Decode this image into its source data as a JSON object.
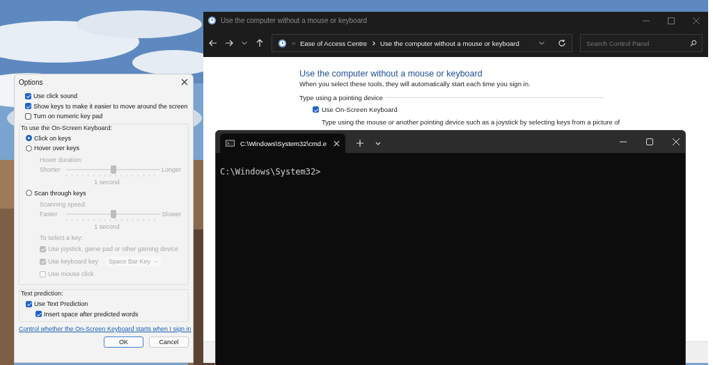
{
  "options": {
    "title": "Options",
    "checkboxes": [
      {
        "label": "Use click sound",
        "checked": true
      },
      {
        "label": "Show keys to make it easier to move around the screen",
        "checked": true
      },
      {
        "label": "Turn on numeric key pad",
        "checked": false
      }
    ],
    "keyboard_group": {
      "legend": "To use the On-Screen Keyboard:",
      "modes": [
        {
          "label": "Click on keys",
          "selected": true
        },
        {
          "label": "Hover over keys",
          "selected": false,
          "slider": {
            "caption": "Hover duration:",
            "min_label": "Shorter",
            "max_label": "Longer",
            "level": 0.5,
            "reading": "1 second",
            "disabled": true
          }
        },
        {
          "label": "Scan through keys",
          "selected": false,
          "slider": {
            "caption": "Scanning speed:",
            "min_label": "Faster",
            "max_label": "Slower",
            "level": 0.5,
            "reading": "1 second",
            "disabled": true
          }
        }
      ],
      "select_key": {
        "caption": "To select a key:",
        "disabled": true,
        "options": [
          {
            "kind": "checkbox",
            "label": "Use joystick, game pad or other gaming device",
            "checked": true
          },
          {
            "kind": "checkbox_dropdown",
            "label": "Use keyboard key",
            "checked": true,
            "dropdown": "Space Bar Key"
          },
          {
            "kind": "checkbox",
            "label": "Use mouse click",
            "checked": false
          }
        ]
      }
    },
    "prediction_group": {
      "legend": "Text prediction:",
      "options": [
        {
          "label": "Use Text Prediction",
          "checked": true,
          "children": [
            {
              "label": "Insert space after predicted words",
              "checked": true
            }
          ]
        }
      ]
    },
    "link": "Control whether the On-Screen Keyboard starts when I sign in",
    "buttons": [
      {
        "label": "OK",
        "default": true
      },
      {
        "label": "Cancel",
        "default": false
      }
    ]
  },
  "control_panel": {
    "title": "Use the computer without a mouse or keyboard",
    "breadcrumb": [
      "Ease of Access Centre",
      "Use the computer without a mouse or keyboard"
    ],
    "search": {
      "placeholder": "Search Control Panel"
    },
    "heading": "Use the computer without a mouse or keyboard",
    "subtitle": "When you select these tools, they will automatically start each time you sign in.",
    "section": "Type using a pointing device",
    "checkbox": {
      "label": "Use On-Screen Keyboard",
      "checked": true
    },
    "description": "Type using the mouse or another pointing device such as a joystick by selecting keys from a picture of"
  },
  "terminal": {
    "tabs": [
      {
        "title": "C:\\Windows\\System32\\cmd.e",
        "selected": true
      }
    ],
    "lines": [
      "C:\\Windows\\System32>"
    ]
  }
}
